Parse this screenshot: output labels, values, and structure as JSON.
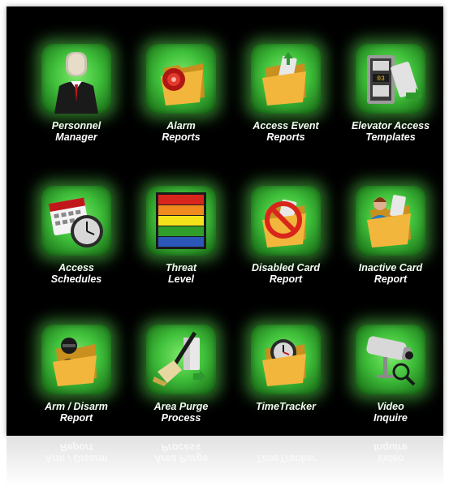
{
  "tiles": [
    {
      "line1": "Personnel",
      "line2": "Manager",
      "icon": "personnel-icon"
    },
    {
      "line1": "Alarm",
      "line2": "Reports",
      "icon": "alarm-folder-icon"
    },
    {
      "line1": "Access Event",
      "line2": "Reports",
      "icon": "access-event-folder-icon"
    },
    {
      "line1": "Elevator Access",
      "line2": "Templates",
      "icon": "elevator-icon"
    },
    {
      "line1": "Access",
      "line2": "Schedules",
      "icon": "calendar-clock-icon"
    },
    {
      "line1": "Threat",
      "line2": "Level",
      "icon": "threat-level-icon"
    },
    {
      "line1": "Disabled Card",
      "line2": "Report",
      "icon": "disabled-card-folder-icon"
    },
    {
      "line1": "Inactive Card",
      "line2": "Report",
      "icon": "inactive-card-folder-icon"
    },
    {
      "line1": "Arm / Disarm",
      "line2": "Report",
      "icon": "arm-disarm-folder-icon"
    },
    {
      "line1": "Area Purge",
      "line2": "Process",
      "icon": "area-purge-icon"
    },
    {
      "line1": "TimeTracker",
      "line2": "",
      "icon": "timetracker-folder-icon"
    },
    {
      "line1": "Video",
      "line2": "Inquire",
      "icon": "video-camera-icon"
    }
  ],
  "colors": {
    "background": "#000000",
    "tile_green": "#3fbf3a",
    "glow": "#5adc50",
    "folder": "#f2b63c",
    "threat_red": "#d9261c",
    "threat_orange": "#f08a1e",
    "threat_yellow": "#f6e21a",
    "threat_green": "#2f9e2a",
    "threat_blue": "#2a57b8"
  }
}
